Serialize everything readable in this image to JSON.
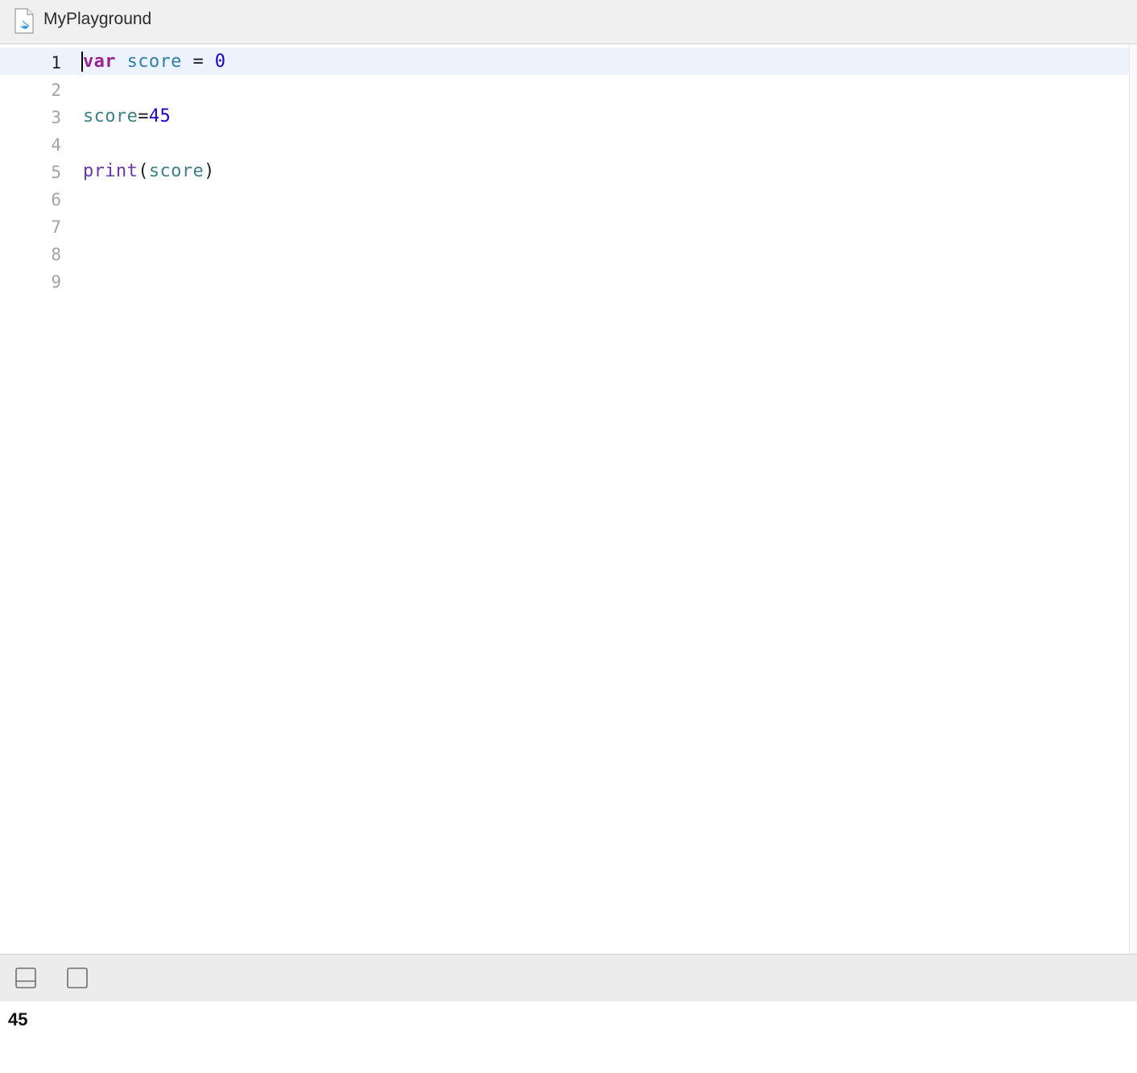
{
  "window": {
    "title": "MyPlayground",
    "file_icon": "swift-file-icon"
  },
  "editor": {
    "current_line": 1,
    "lines": [
      {
        "number": "1",
        "tokens": [
          {
            "text": "var",
            "kind": "keyword"
          },
          {
            "text": " ",
            "kind": "plain"
          },
          {
            "text": "score",
            "kind": "identifier-decl"
          },
          {
            "text": " = ",
            "kind": "plain"
          },
          {
            "text": "0",
            "kind": "number"
          }
        ]
      },
      {
        "number": "2",
        "tokens": []
      },
      {
        "number": "3",
        "tokens": [
          {
            "text": "score",
            "kind": "identifier"
          },
          {
            "text": "=",
            "kind": "plain"
          },
          {
            "text": "45",
            "kind": "number"
          }
        ]
      },
      {
        "number": "4",
        "tokens": []
      },
      {
        "number": "5",
        "tokens": [
          {
            "text": "print",
            "kind": "function"
          },
          {
            "text": "(",
            "kind": "plain"
          },
          {
            "text": "score",
            "kind": "identifier"
          },
          {
            "text": ")",
            "kind": "plain"
          }
        ]
      },
      {
        "number": "6",
        "tokens": []
      },
      {
        "number": "7",
        "tokens": []
      },
      {
        "number": "8",
        "tokens": []
      },
      {
        "number": "9",
        "tokens": []
      }
    ]
  },
  "bottom_bar": {
    "buttons": [
      {
        "name": "toggle-debug-area-button",
        "icon": "panel-bottom-icon"
      },
      {
        "name": "run-playground-button",
        "icon": "square-icon"
      }
    ]
  },
  "console": {
    "output": "45"
  },
  "colors": {
    "keyword": "#9b2393",
    "identifier": "#3e8087",
    "identifier_decl": "#2f7fa8",
    "number": "#1c00cf",
    "function": "#6c36a9",
    "current_line_highlight": "#ecf3fd"
  }
}
